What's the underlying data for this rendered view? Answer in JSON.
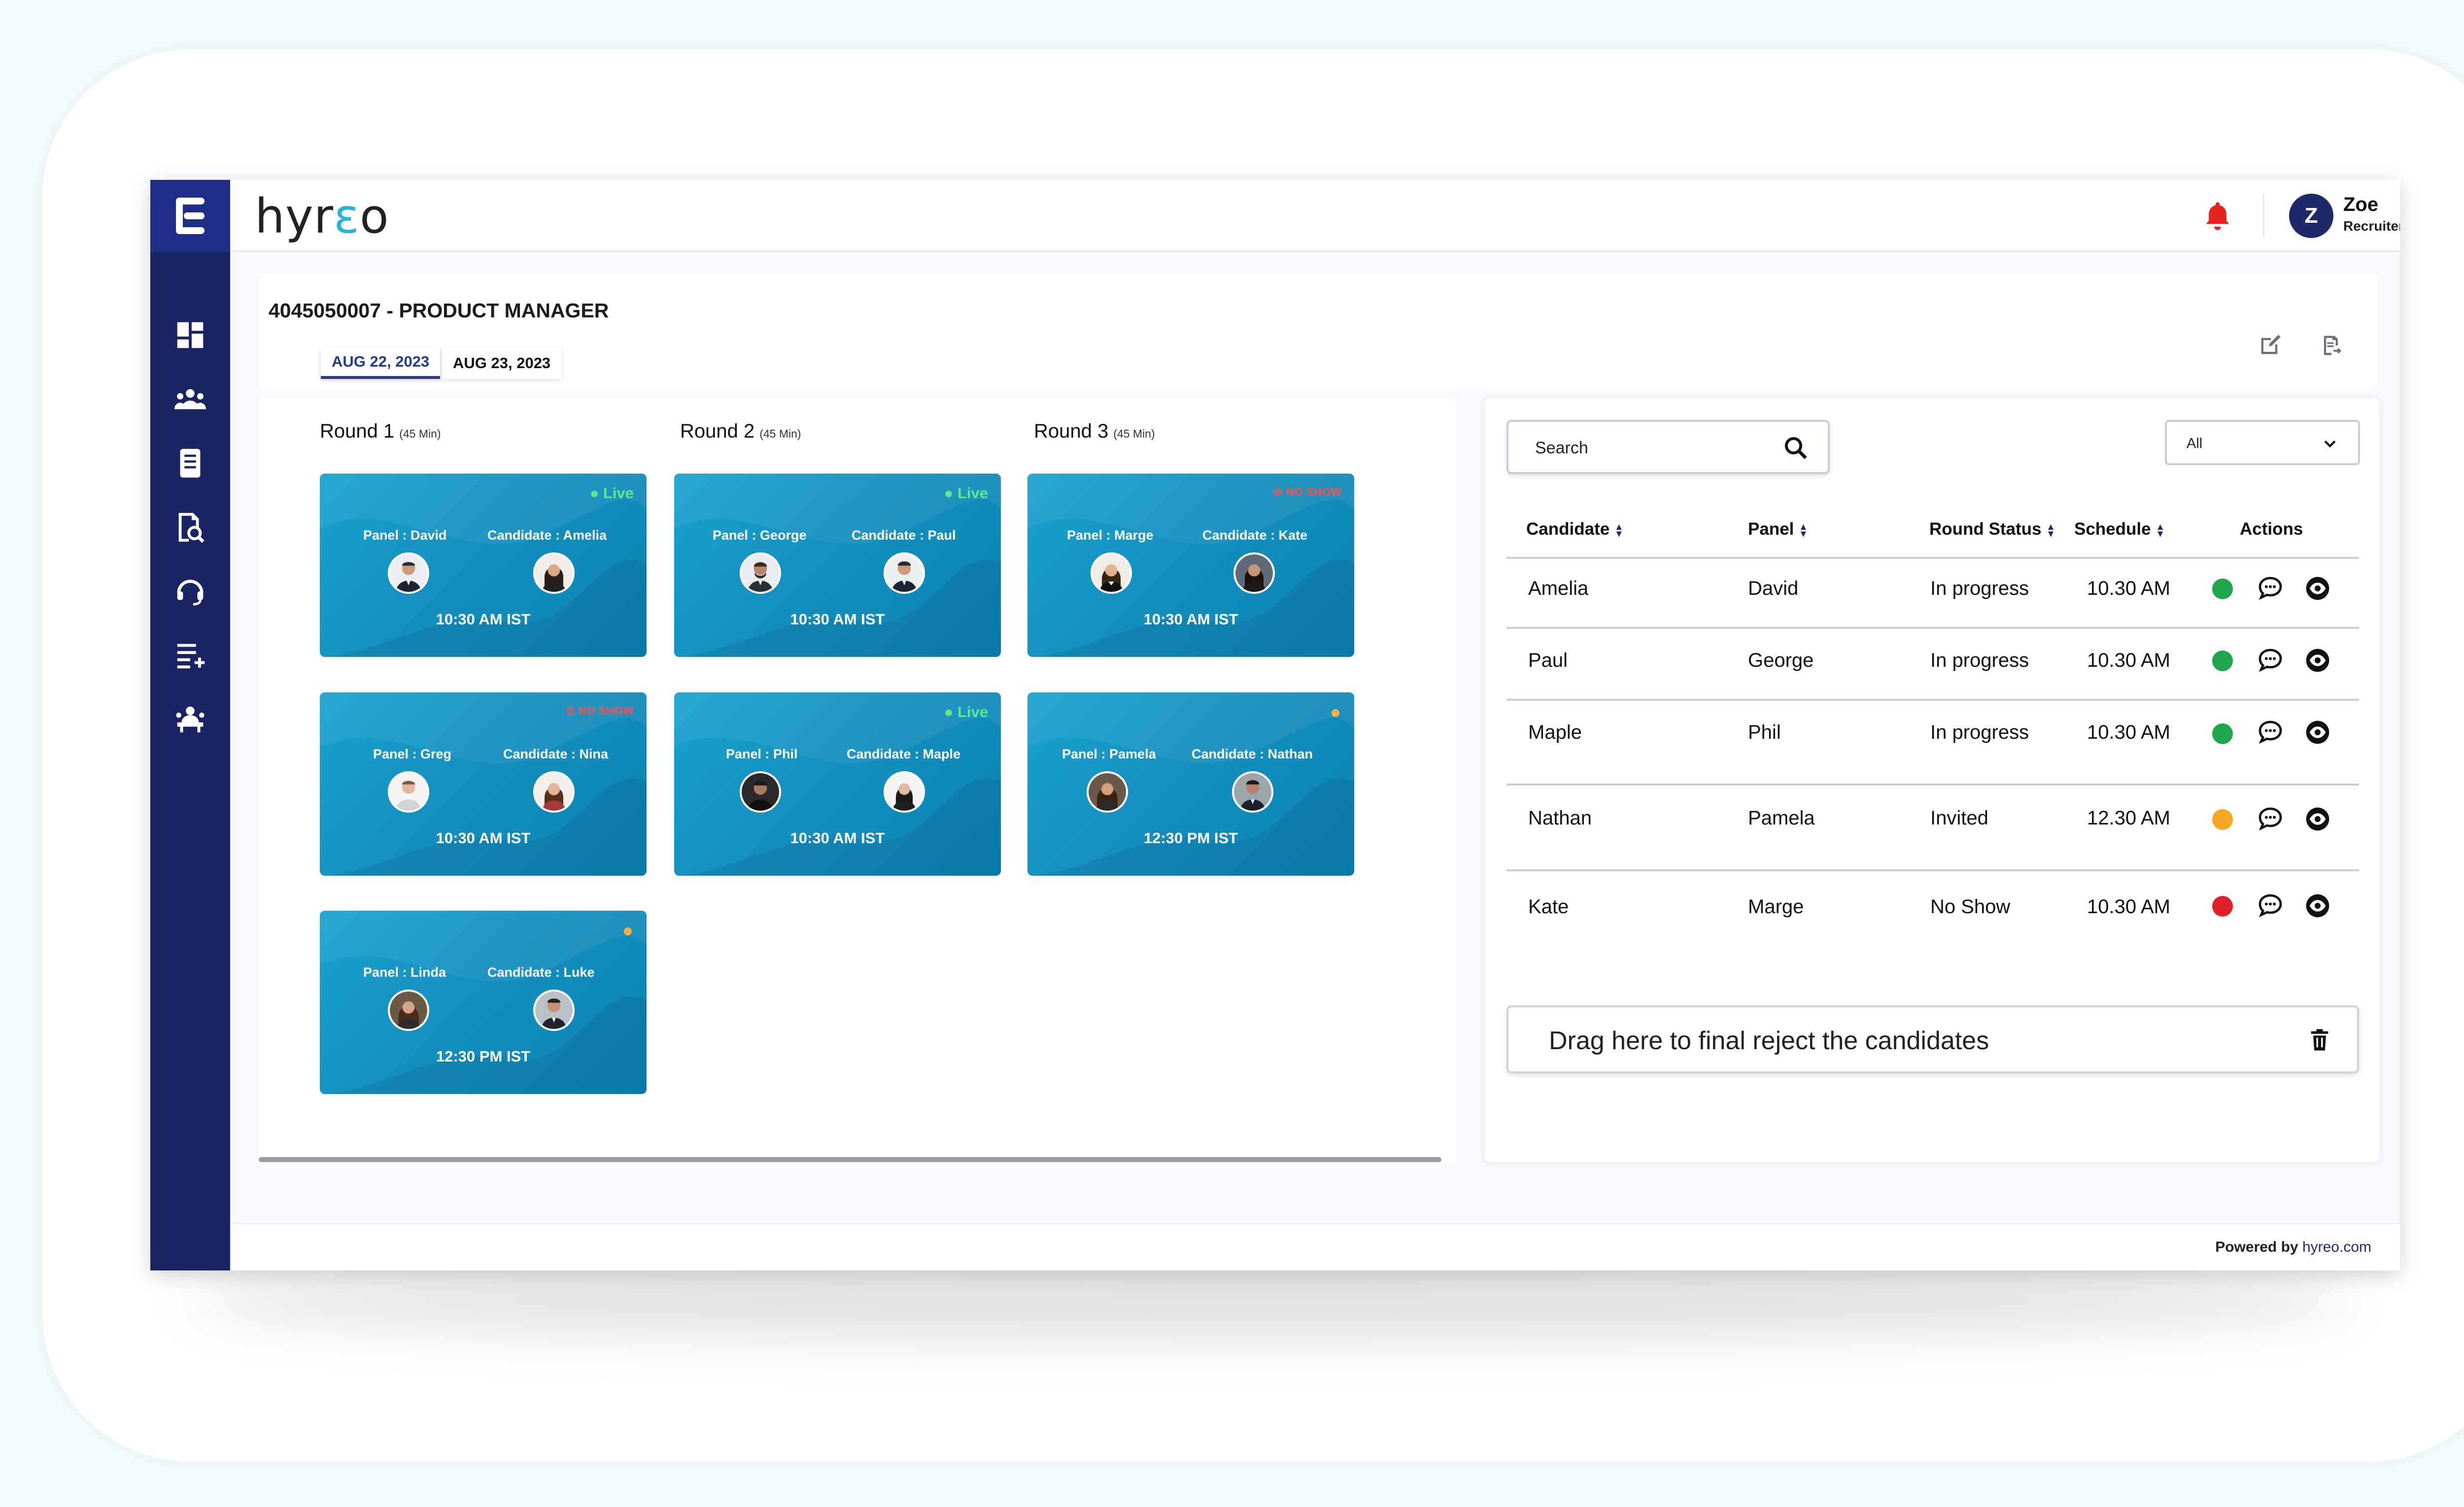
{
  "app": {
    "brand_prefix": "hyr",
    "brand_accent": "ε",
    "brand_suffix": "o",
    "user_initial": "Z",
    "user_name": "Zoe",
    "user_role": "Recruiter"
  },
  "colors": {
    "sidebar": "#1b2463",
    "card": "#1590bf",
    "live": "#5ce98e",
    "noshow": "#ff4d4d",
    "in_progress": "#1fa64a",
    "invited": "#f5a623",
    "no_show_dot": "#e0202a"
  },
  "sidebar": {
    "items": [
      "dashboard-icon",
      "team-icon",
      "document-icon",
      "search-report-icon",
      "support-icon",
      "list-add-icon",
      "interview-icon"
    ]
  },
  "header": {
    "job_title": "4045050007 - PRODUCT MANAGER",
    "dates": [
      "AUG 22, 2023",
      "AUG 23, 2023"
    ],
    "active_date": "AUG 22, 2023"
  },
  "rounds": [
    {
      "title": "Round 1",
      "duration": "(45 Min)"
    },
    {
      "title": "Round 2",
      "duration": "(45 Min)"
    },
    {
      "title": "Round 3",
      "duration": "(45 Min)"
    }
  ],
  "cards": [
    {
      "status": "● Live",
      "panel": "Panel : David",
      "candidate": "Candidate : Amelia",
      "time": "10:30 AM IST"
    },
    {
      "status": "● Live",
      "panel": "Panel : George",
      "candidate": "Candidate : Paul",
      "time": "10:30 AM IST"
    },
    {
      "status": "⊘ NO SHOW",
      "panel": "Panel : Marge",
      "candidate": "Candidate : Kate",
      "time": "10:30 AM IST"
    },
    {
      "status": "⊘ NO SHOW",
      "panel": "Panel : Greg",
      "candidate": "Candidate : Nina",
      "time": "10:30 AM IST"
    },
    {
      "status": "● Live",
      "panel": "Panel : Phil",
      "candidate": "Candidate : Maple",
      "time": "10:30 AM IST"
    },
    {
      "status": "",
      "panel": "Panel : Pamela",
      "candidate": "Candidate : Nathan",
      "time": "12:30 PM IST"
    },
    {
      "status": "",
      "panel": "Panel : Linda",
      "candidate": "Candidate : Luke",
      "time": "12:30 PM IST"
    }
  ],
  "search": {
    "placeholder": "Search"
  },
  "filter": {
    "value": "All"
  },
  "table": {
    "headers": [
      "Candidate",
      "Panel",
      "Round Status",
      "Schedule",
      "Actions"
    ],
    "rows": [
      {
        "candidate": "Amelia",
        "panel": "David",
        "status": "In progress",
        "schedule": "10.30 AM"
      },
      {
        "candidate": "Paul",
        "panel": "George",
        "status": "In progress",
        "schedule": "10.30 AM"
      },
      {
        "candidate": "Maple",
        "panel": "Phil",
        "status": "In progress",
        "schedule": "10.30 AM"
      },
      {
        "candidate": "Nathan",
        "panel": "Pamela",
        "status": "Invited",
        "schedule": "12.30 AM"
      },
      {
        "candidate": "Kate",
        "panel": "Marge",
        "status": "No Show",
        "schedule": "10.30 AM"
      }
    ]
  },
  "dropzone": {
    "label": "Drag here to final reject the candidates"
  },
  "footer": {
    "prefix": "Powered by ",
    "link": "hyreo.com"
  }
}
